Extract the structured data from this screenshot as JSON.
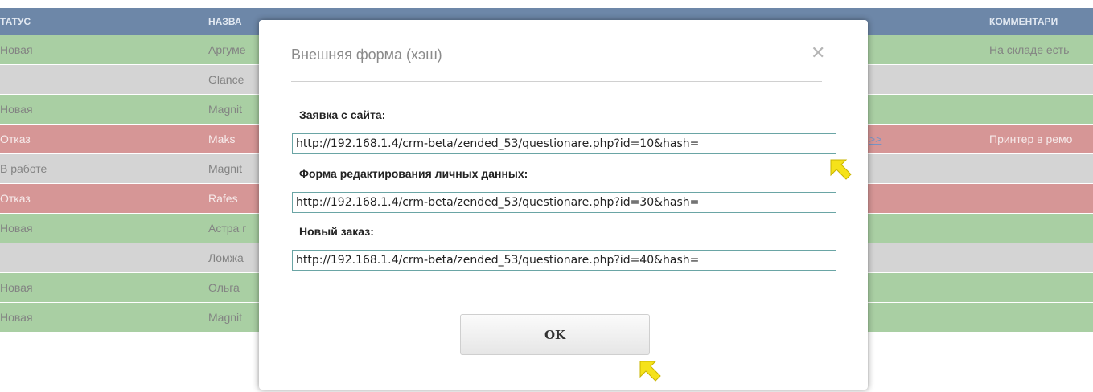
{
  "table": {
    "headers": {
      "status": "ТАТУС",
      "name": "НАЗВА",
      "comment": "КОММЕНТАРИ"
    },
    "rows": [
      {
        "status": "Новая",
        "name": "Аргуме",
        "link": "",
        "comment": "На складе есть",
        "color": "green"
      },
      {
        "status": "",
        "name": "Glance",
        "link": "",
        "comment": "",
        "color": "grey"
      },
      {
        "status": "Новая",
        "name": "Magnit",
        "link": "",
        "comment": "",
        "color": "green"
      },
      {
        "status": "Отказ",
        "name": "Maks",
        "link": ">>",
        "comment": "Принтер в ремо",
        "color": "red"
      },
      {
        "status": "В работе",
        "name": "Magnit",
        "link": "",
        "comment": "",
        "color": "grey"
      },
      {
        "status": "Отказ",
        "name": "Rafes",
        "link": "",
        "comment": "",
        "color": "red"
      },
      {
        "status": "Новая",
        "name": "Астра г",
        "link": "",
        "comment": "",
        "color": "green"
      },
      {
        "status": "",
        "name": "Ломжа",
        "link": "",
        "comment": "",
        "color": "grey"
      },
      {
        "status": "Новая",
        "name": "Ольга",
        "link": "",
        "comment": "",
        "color": "green"
      },
      {
        "status": "Новая",
        "name": "Magnit",
        "link": "",
        "comment": "",
        "color": "green"
      }
    ]
  },
  "modal": {
    "title": "Внешняя форма (хэш)",
    "close_icon": "close-icon",
    "fields": [
      {
        "label": "Заявка с сайта:",
        "value": "http://192.168.1.4/crm-beta/zended_53/questionare.php?id=10&hash="
      },
      {
        "label": "Форма редактирования личных данных:",
        "value": "http://192.168.1.4/crm-beta/zended_53/questionare.php?id=30&hash="
      },
      {
        "label": "Новый заказ:",
        "value": "http://192.168.1.4/crm-beta/zended_53/questionare.php?id=40&hash="
      }
    ],
    "ok_label": "OK"
  },
  "colors": {
    "header": "#3c5f8b",
    "green_row": "#8cbf84",
    "grey_row": "#c6c6c6",
    "red_row": "#c97373",
    "arrow": "#f5e21a"
  }
}
